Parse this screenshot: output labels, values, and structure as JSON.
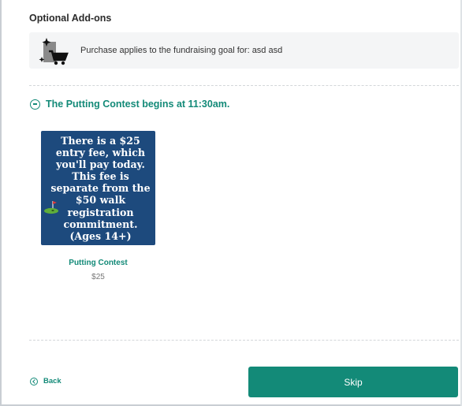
{
  "section": {
    "title": "Optional Add-ons"
  },
  "banner": {
    "icon": "shopping-cart-sparkle-icon",
    "text": "Purchase applies to the fundraising goal for: asd asd"
  },
  "group": {
    "icon": "minus-circle-icon",
    "title": "The Putting Contest begins at 11:30am."
  },
  "product": {
    "image_text": "There is a $25 entry fee, which you'll pay today. This fee is separate from the $50 walk registration commitment. (Ages 14+)",
    "image_icon": "golf-hole-icon",
    "image_background": "#1d4a7d",
    "name": "Putting Contest",
    "price": "$25"
  },
  "footer": {
    "back_icon": "chevron-left-circle-icon",
    "back_label": "Back",
    "skip_label": "Skip"
  },
  "colors": {
    "accent": "#138a78",
    "banner_bg": "#f4f5f6"
  }
}
